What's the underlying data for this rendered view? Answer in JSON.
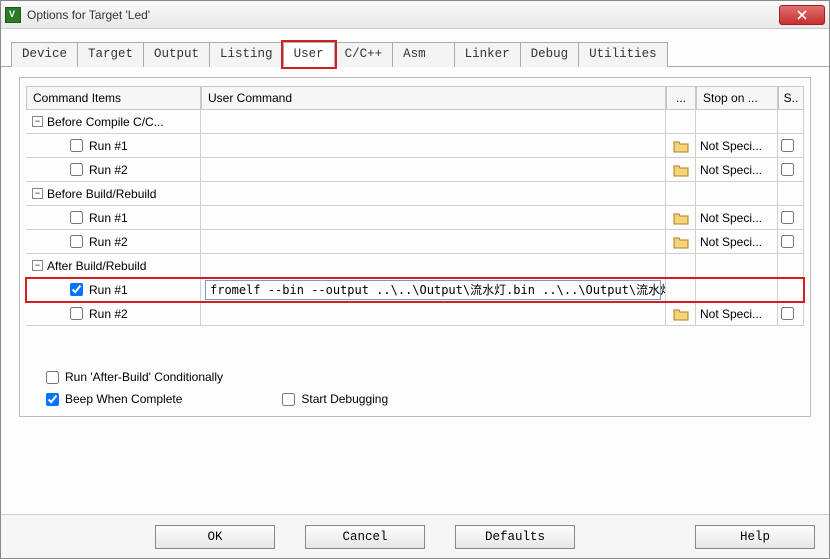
{
  "window": {
    "title": "Options for Target 'Led'"
  },
  "tabs": [
    "Device",
    "Target",
    "Output",
    "Listing",
    "User",
    "C/C++",
    "Asm",
    "Linker",
    "Debug",
    "Utilities"
  ],
  "active_tab": "User",
  "columns": {
    "items": "Command Items",
    "cmd": "User Command",
    "browse": "...",
    "stop": "Stop on ...",
    "spawn": "S.."
  },
  "groups": {
    "g0": {
      "label": "Before Compile C/C..."
    },
    "g1": {
      "label": "Before Build/Rebuild"
    },
    "g2": {
      "label": "After Build/Rebuild"
    }
  },
  "rows": {
    "r1": {
      "label": "Run #1",
      "stop": "Not Speci..."
    },
    "r2": {
      "label": "Run #2",
      "stop": "Not Speci..."
    },
    "r3": {
      "label": "Run #1",
      "stop": "Not Speci..."
    },
    "r4": {
      "label": "Run #2",
      "stop": "Not Speci..."
    },
    "r5": {
      "label": "Run #1",
      "cmd": "fromelf --bin --output ..\\..\\Output\\流水灯.bin ..\\..\\Output\\流水灯.axf"
    },
    "r6": {
      "label": "Run #2",
      "stop": "Not Speci..."
    }
  },
  "opts": {
    "run_cond": "Run 'After-Build' Conditionally",
    "beep": "Beep When Complete",
    "debug": "Start Debugging"
  },
  "buttons": {
    "ok": "OK",
    "cancel": "Cancel",
    "defaults": "Defaults",
    "help": "Help"
  }
}
